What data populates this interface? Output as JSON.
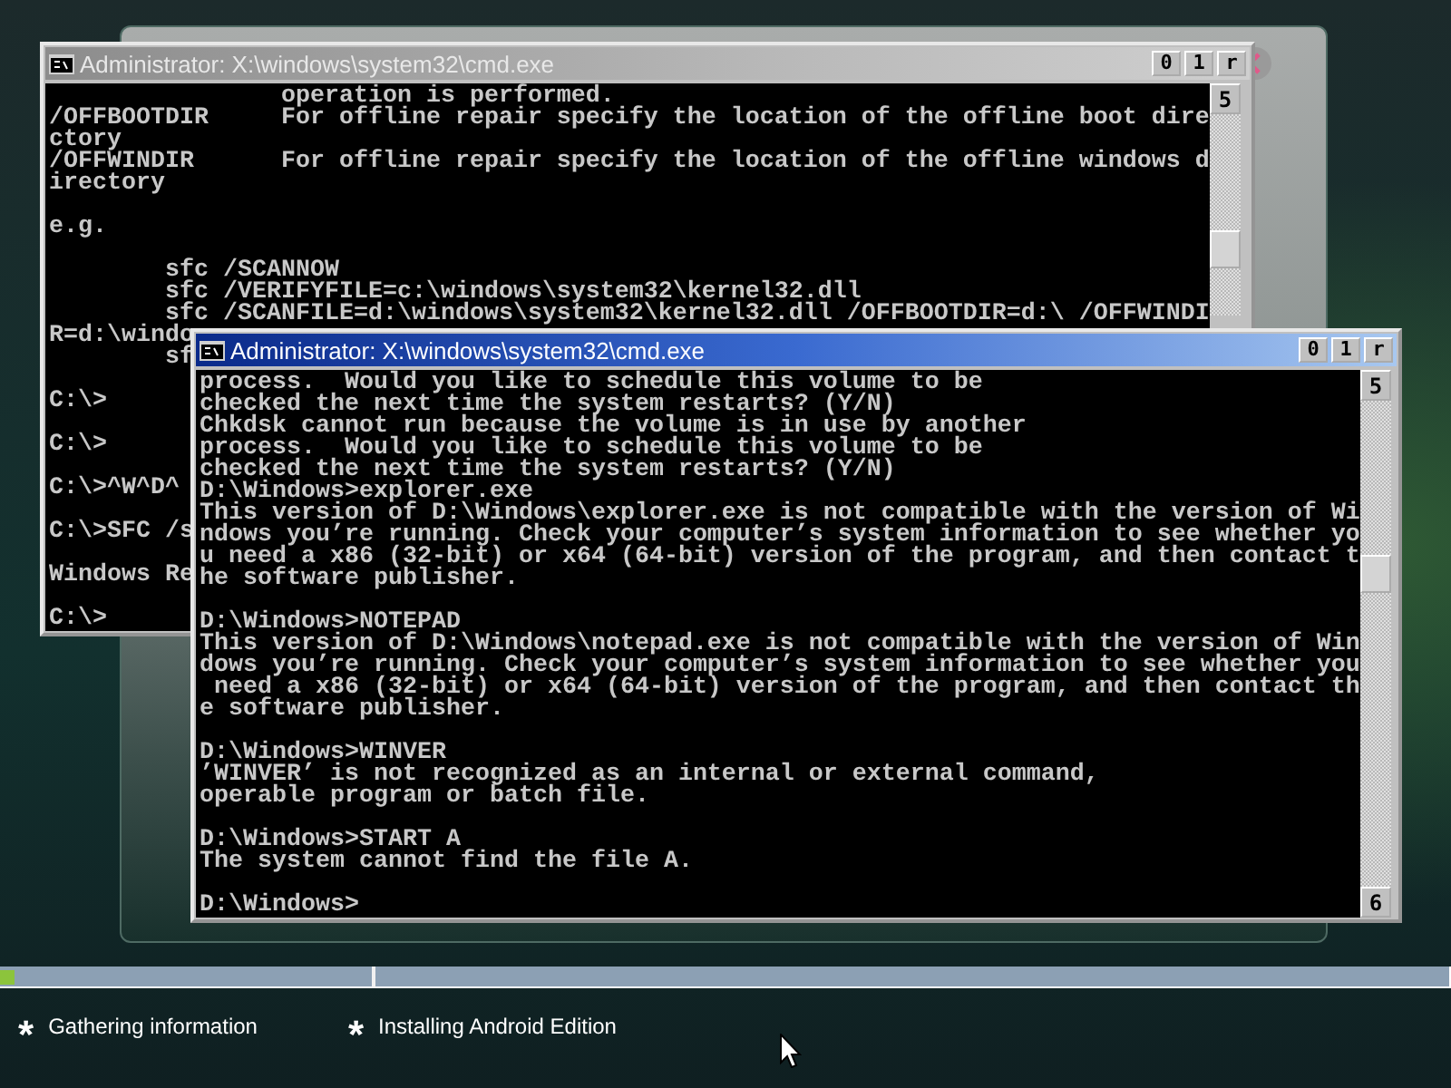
{
  "windows": [
    {
      "title": "Administrator: X:\\windows\\system32\\cmd.exe",
      "active": false,
      "buttons": [
        "0",
        "1",
        "r"
      ],
      "scroll_buttons": [
        "5"
      ],
      "blocks": [
        [
          "                operation is performed.",
          "/OFFBOOTDIR     For offline repair specify the location of the offline boot dire",
          "ctory",
          "/OFFWINDIR      For offline repair specify the location of the offline windows d",
          "irectory"
        ],
        [
          "e.g."
        ],
        [
          "        sfc /SCANNOW",
          "        sfc /VERIFYFILE=c:\\windows\\system32\\kernel32.dll",
          "        sfc /SCANFILE=d:\\windows\\system32\\kernel32.dll /OFFBOOTDIR=d:\\ /OFFWINDI",
          "R=d:\\windo",
          "        sf"
        ],
        [
          "C:\\>"
        ],
        [
          "C:\\>"
        ],
        [
          "C:\\>^W^D^"
        ],
        [
          "C:\\>SFC /s"
        ],
        [
          "Windows Re"
        ],
        [
          "C:\\>"
        ]
      ]
    },
    {
      "title": "Administrator: X:\\windows\\system32\\cmd.exe",
      "active": true,
      "buttons": [
        "0",
        "1",
        "r"
      ],
      "scroll_buttons": [
        "5",
        "6"
      ],
      "blocks": [
        [
          "process.  Would you like to schedule this volume to be",
          "checked the next time the system restarts? (Y/N)",
          "Chkdsk cannot run because the volume is in use by another",
          "process.  Would you like to schedule this volume to be",
          "checked the next time the system restarts? (Y/N)",
          "D:\\Windows>explorer.exe",
          "This version of D:\\Windows\\explorer.exe is not compatible with the version of Wi",
          "ndows you’re running. Check your computer’s system information to see whether yo",
          "u need a x86 (32-bit) or x64 (64-bit) version of the program, and then contact t",
          "he software publisher."
        ],
        [
          "D:\\Windows>NOTEPAD",
          "This version of D:\\Windows\\notepad.exe is not compatible with the version of Win",
          "dows you’re running. Check your computer’s system information to see whether you",
          " need a x86 (32-bit) or x64 (64-bit) version of the program, and then contact th",
          "e software publisher."
        ],
        [
          "D:\\Windows>WINVER",
          "’WINVER’ is not recognized as an internal or external command,",
          "operable program or batch file."
        ],
        [
          "D:\\Windows>START A",
          "The system cannot find the file A."
        ],
        [
          "D:\\Windows>"
        ]
      ]
    }
  ],
  "progress": {
    "level": 0.01
  },
  "status_items": [
    {
      "bullet": "*",
      "label": "Gathering information"
    },
    {
      "bullet": "*",
      "label": "Installing Android Edition"
    }
  ]
}
